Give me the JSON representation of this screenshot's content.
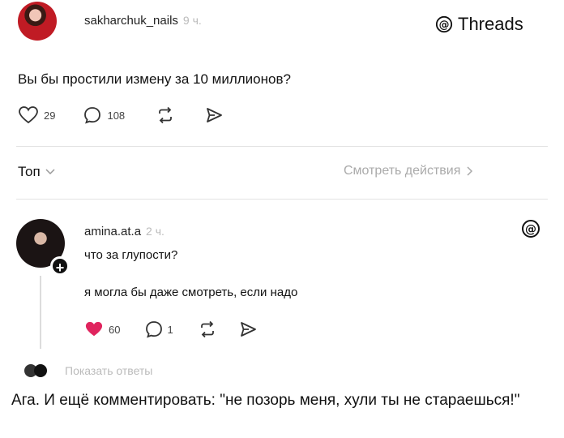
{
  "post": {
    "username": "sakharchuk_nails",
    "time": "9 ч.",
    "brand": "Threads",
    "text": "Вы бы простили измену за 10 миллионов?",
    "likes": "29",
    "replies": "108"
  },
  "filter": {
    "sort_label": "Топ",
    "activity_link": "Смотреть действия"
  },
  "reply": {
    "username": "amina.at.a",
    "time": "2 ч.",
    "text": "что за глупости?",
    "subtext": "я могла бы даже смотреть, если надо",
    "likes": "60",
    "replies": "1",
    "show_replies": "Показать ответы"
  },
  "caption": "Ага. И ещё комментировать: \"не позорь меня, хули ты не стараешься!\"",
  "colors": {
    "like_red": "#e0245e",
    "muted": "#aaaaaa"
  },
  "icons": [
    "heart-icon",
    "comment-icon",
    "repost-icon",
    "share-icon",
    "threads-logo-icon",
    "chevron-down-icon",
    "chevron-right-icon"
  ]
}
